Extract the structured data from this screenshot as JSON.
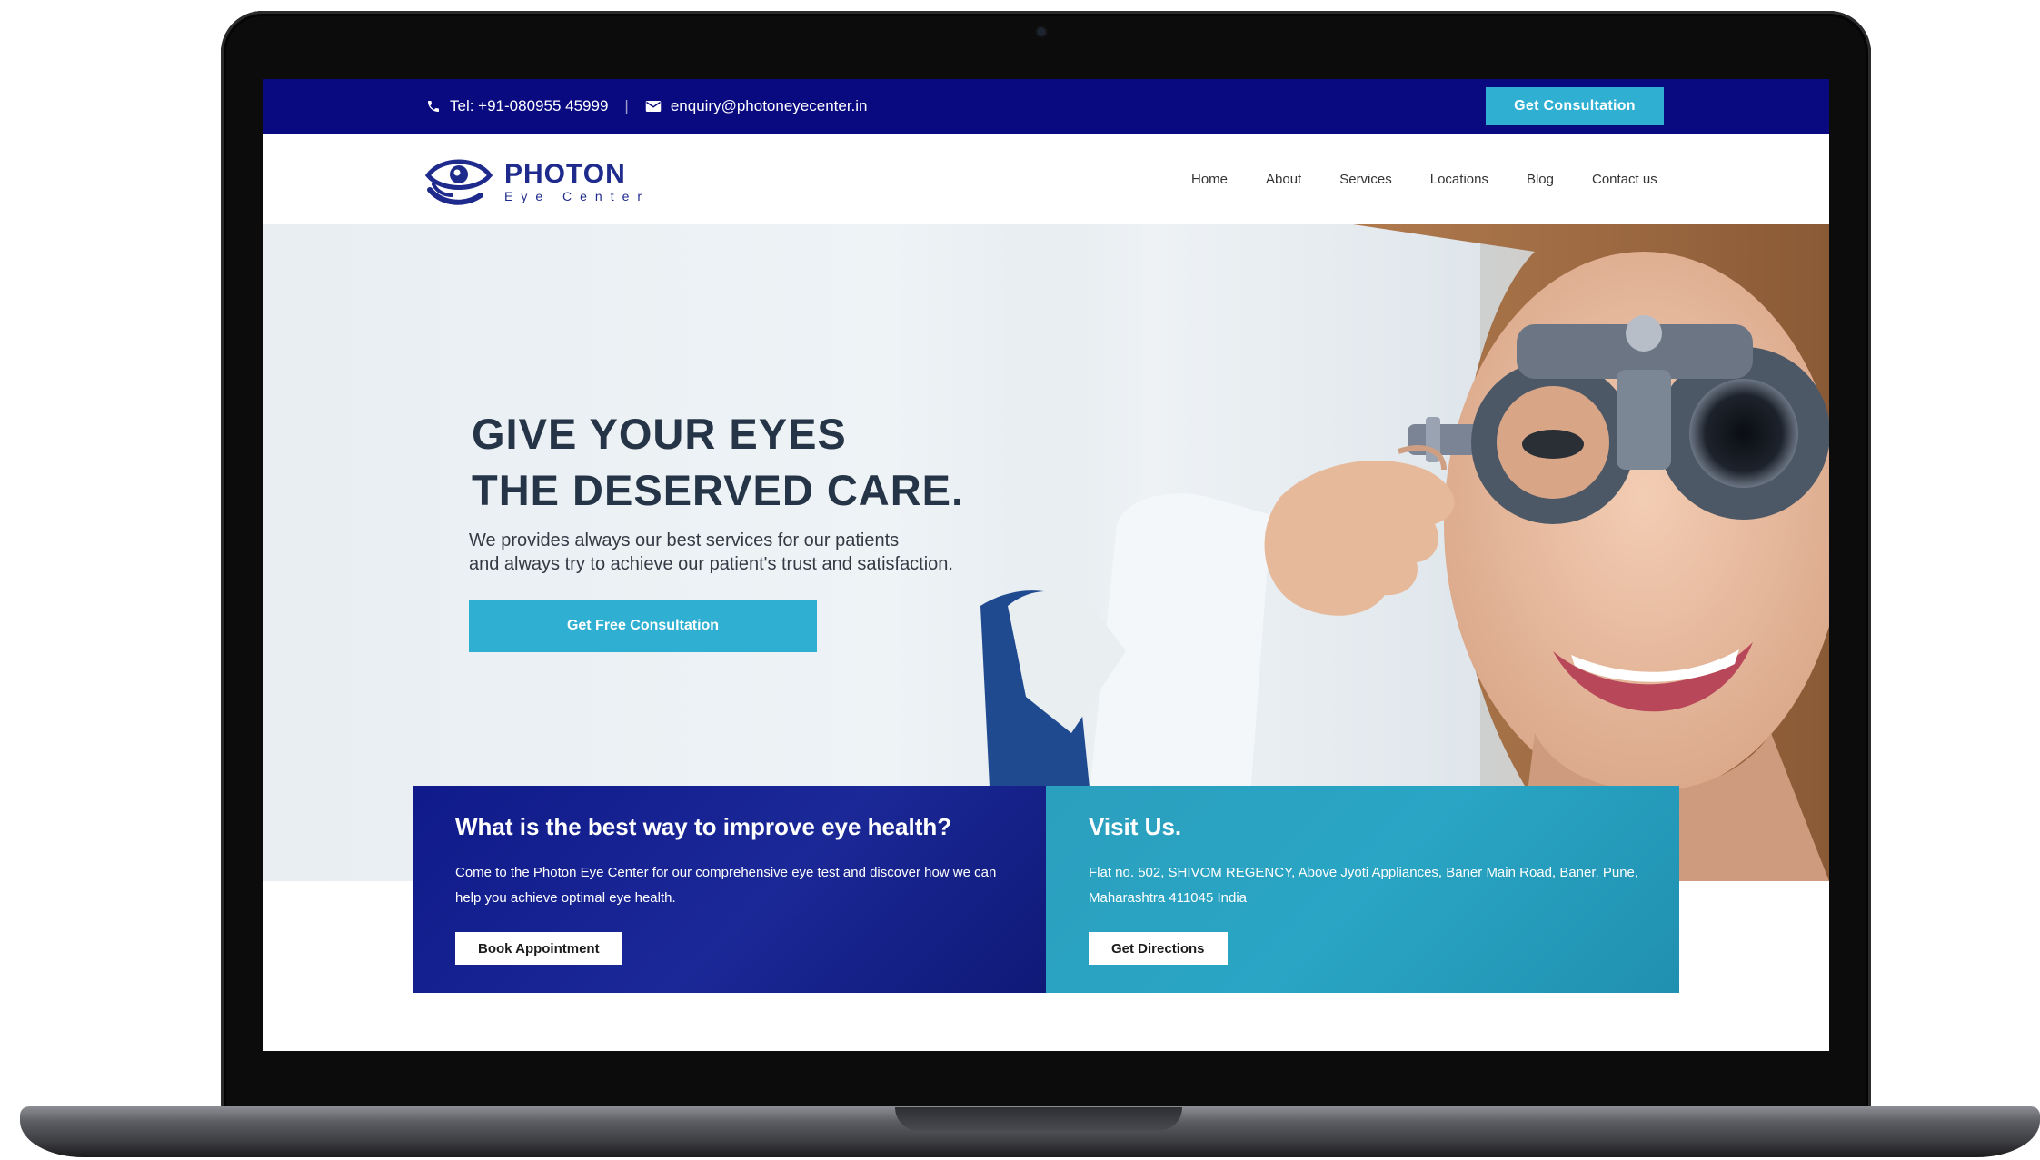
{
  "topbar": {
    "phone": "Tel: +91-080955 45999",
    "separator": "|",
    "email": "enquiry@photoneyecenter.in",
    "cta_label": "Get Consultation"
  },
  "logo": {
    "name": "PHOTON",
    "subtitle": "Eye Center"
  },
  "nav": {
    "items": [
      {
        "label": "Home"
      },
      {
        "label": "About"
      },
      {
        "label": "Services"
      },
      {
        "label": "Locations"
      },
      {
        "label": "Blog"
      },
      {
        "label": "Contact us"
      }
    ]
  },
  "hero": {
    "title_line1": "GIVE YOUR EYES",
    "title_line2": "THE DESERVED CARE.",
    "text_line1": "We provides always our best services for our patients",
    "text_line2": "and always try to achieve our patient's trust and satisfaction.",
    "cta_label": "Get Free Consultation"
  },
  "cards": {
    "health": {
      "title": "What is the best way to improve eye health?",
      "text": "Come to the Photon Eye Center for our comprehensive eye test and discover how we can help you achieve optimal eye health.",
      "button": "Book Appointment"
    },
    "visit": {
      "title": "Visit Us.",
      "text": "Flat no. 502, SHIVOM REGENCY, Above Jyoti Appliances, Baner Main Road, Baner, Pune, Maharashtra 411045 India",
      "button": "Get Directions"
    }
  },
  "colors": {
    "topbar": "#0a0a80",
    "accent": "#2fb0d2",
    "brand": "#1e2a8c",
    "card_health": "#1b2897",
    "card_visit": "#2aa5c4"
  },
  "icons": {
    "phone": "phone-icon",
    "email": "mail-icon",
    "logo": "eye-hand-icon"
  }
}
